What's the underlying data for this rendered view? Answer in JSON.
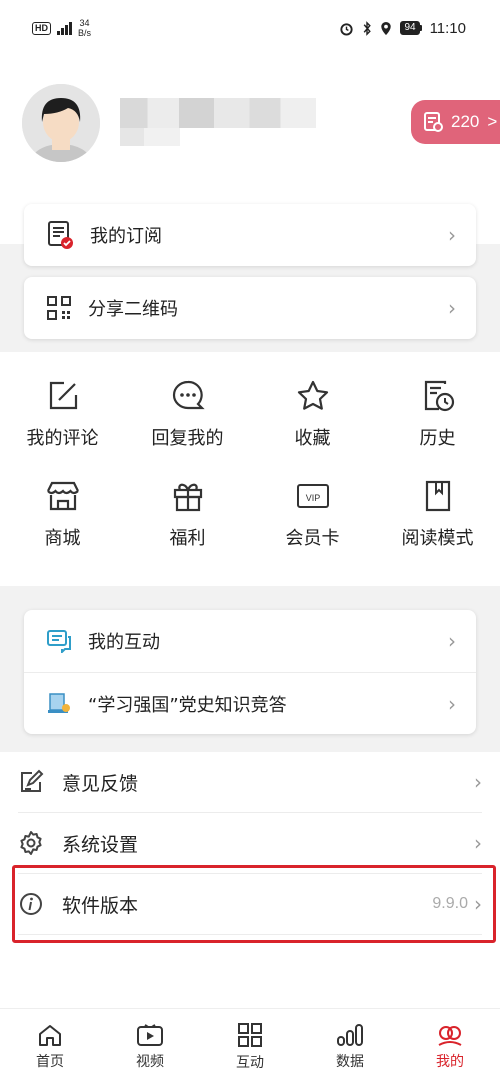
{
  "status_bar": {
    "hd": "HD",
    "net_speed_value": "34",
    "net_speed_unit": "B/s",
    "battery": "94",
    "time": "11:10"
  },
  "profile": {
    "score_value": "220",
    "score_arrow": ">"
  },
  "cards": {
    "subscription": {
      "label": "我的订阅",
      "icon": "subscription-doc-icon"
    },
    "qrcode": {
      "label": "分享二维码",
      "icon": "qrcode-icon"
    }
  },
  "grid": [
    {
      "label": "我的评论",
      "icon": "edit-icon"
    },
    {
      "label": "回复我的",
      "icon": "chat-bubble-icon"
    },
    {
      "label": "收藏",
      "icon": "star-icon"
    },
    {
      "label": "历史",
      "icon": "history-icon"
    },
    {
      "label": "商城",
      "icon": "shop-icon"
    },
    {
      "label": "福利",
      "icon": "gift-icon"
    },
    {
      "label": "会员卡",
      "icon": "vip-card-icon"
    },
    {
      "label": "阅读模式",
      "icon": "book-icon"
    }
  ],
  "interaction_card": {
    "items": [
      {
        "label": "我的互动",
        "icon": "chat-icon"
      },
      {
        "label": "“学习强国”党史知识竞答",
        "icon": "quiz-icon"
      }
    ]
  },
  "list": {
    "feedback": "意见反馈",
    "settings": "系统设置",
    "version_label": "软件版本",
    "version_value": "9.9.0"
  },
  "tabs": [
    {
      "label": "首页",
      "icon": "home-icon"
    },
    {
      "label": "视频",
      "icon": "video-icon"
    },
    {
      "label": "互动",
      "icon": "grid-icon"
    },
    {
      "label": "数据",
      "icon": "chart-icon"
    },
    {
      "label": "我的",
      "icon": "me-icon",
      "active": true
    }
  ],
  "colors": {
    "accent_red": "#d9232b",
    "score_pill": "#e0647a",
    "section_bg": "#f2f2f2"
  }
}
